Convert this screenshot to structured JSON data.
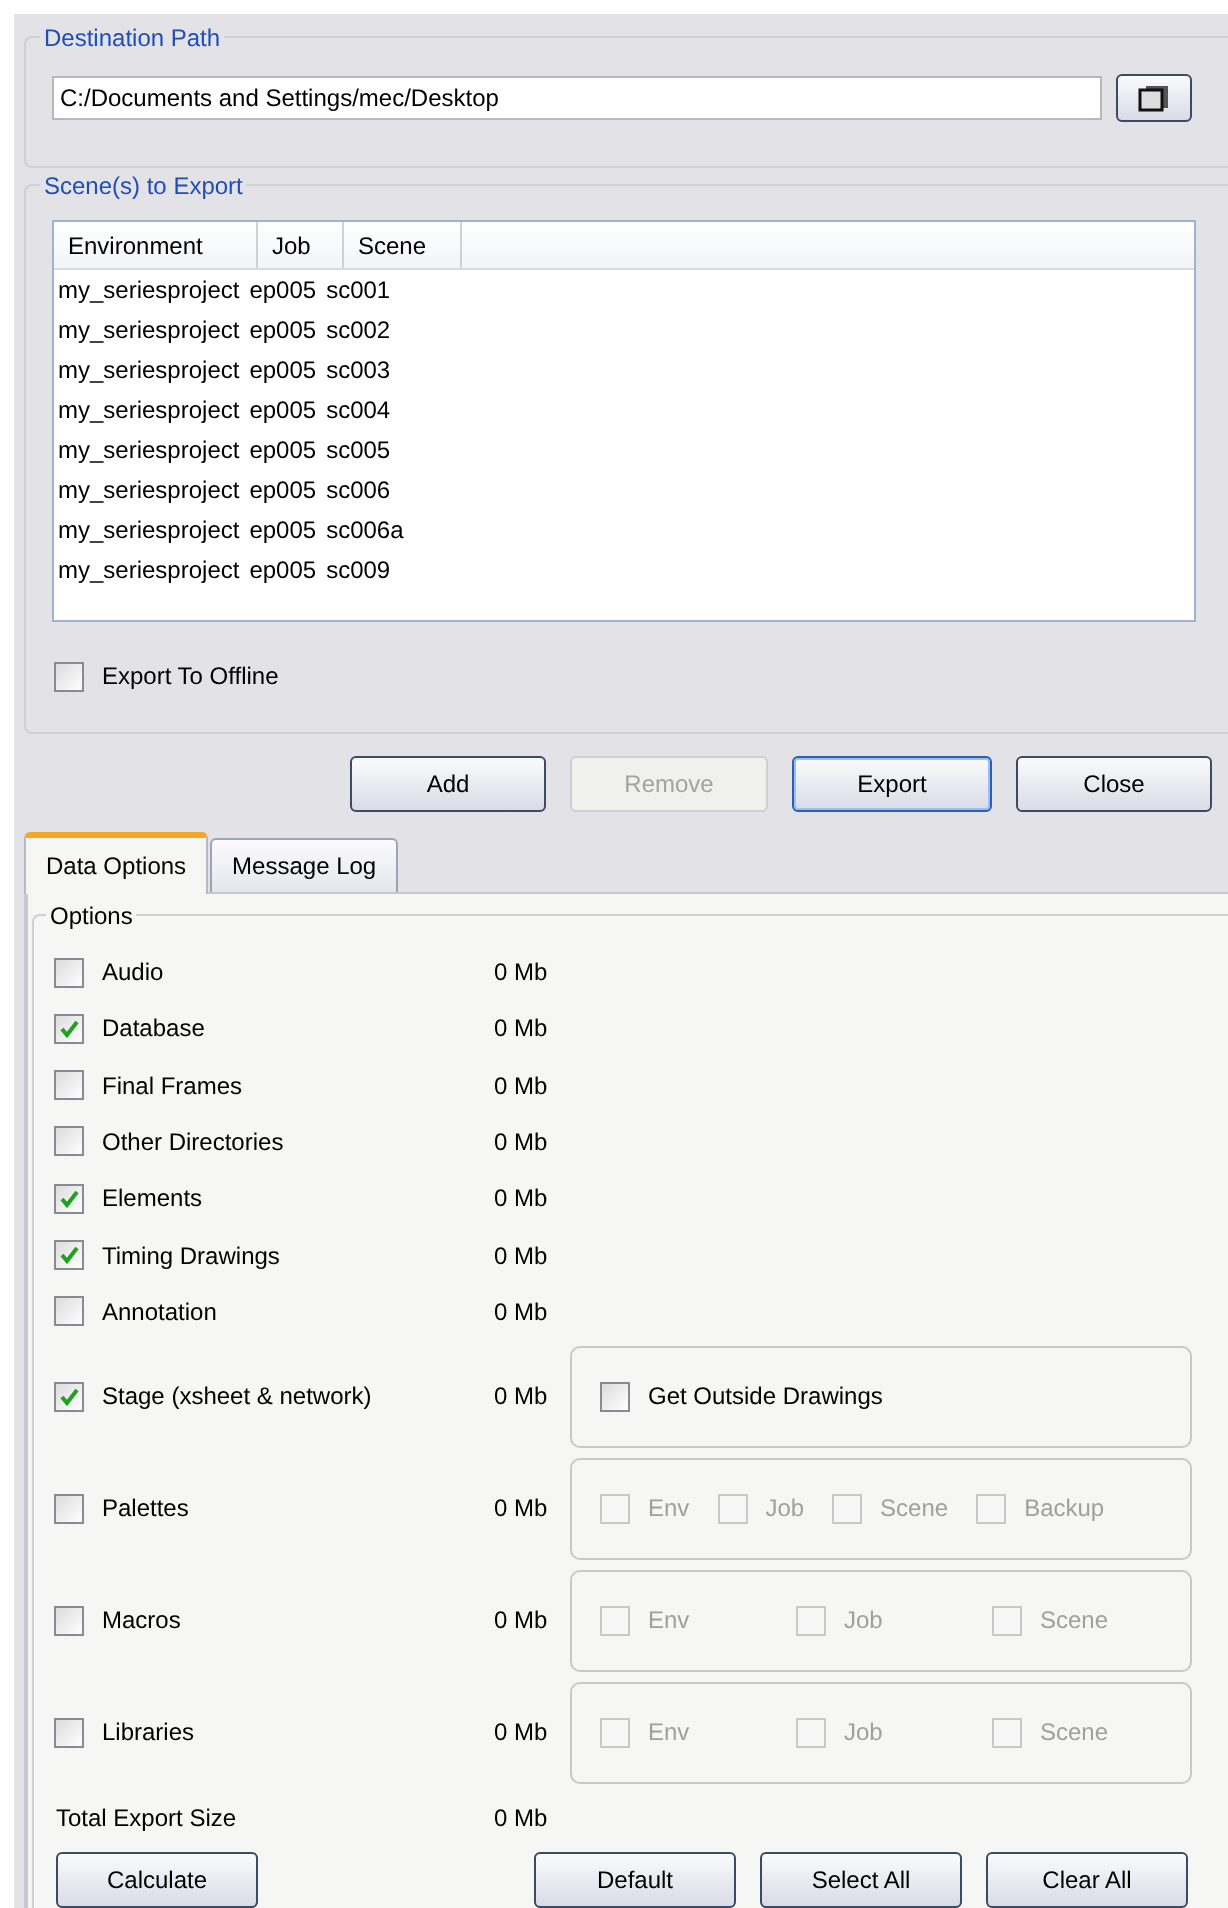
{
  "destination": {
    "legend": "Destination Path",
    "value": "C:/Documents and Settings/mec/Desktop"
  },
  "scenes": {
    "legend": "Scene(s) to Export",
    "columns": [
      "Environment",
      "Job",
      "Scene"
    ],
    "rows": [
      [
        "my_seriesproject",
        "ep005",
        "sc001"
      ],
      [
        "my_seriesproject",
        "ep005",
        "sc002"
      ],
      [
        "my_seriesproject",
        "ep005",
        "sc003"
      ],
      [
        "my_seriesproject",
        "ep005",
        "sc004"
      ],
      [
        "my_seriesproject",
        "ep005",
        "sc005"
      ],
      [
        "my_seriesproject",
        "ep005",
        "sc006"
      ],
      [
        "my_seriesproject",
        "ep005",
        "sc006a"
      ],
      [
        "my_seriesproject",
        "ep005",
        "sc009"
      ]
    ],
    "export_offline": {
      "label": "Export To Offline",
      "checked": false
    }
  },
  "actions": [
    {
      "label": "Add",
      "disabled": false,
      "default": false
    },
    {
      "label": "Remove",
      "disabled": true,
      "default": false
    },
    {
      "label": "Export",
      "disabled": false,
      "default": true
    },
    {
      "label": "Close",
      "disabled": false,
      "default": false
    }
  ],
  "tabs": [
    {
      "label": "Data Options",
      "selected": true
    },
    {
      "label": "Message Log",
      "selected": false
    }
  ],
  "options": {
    "legend": "Options",
    "items": [
      {
        "label": "Audio",
        "checked": false,
        "size": "0 Mb"
      },
      {
        "label": "Database",
        "checked": true,
        "size": "0 Mb"
      },
      {
        "label": "Final Frames",
        "checked": false,
        "size": "0 Mb"
      },
      {
        "label": "Other Directories",
        "checked": false,
        "size": "0 Mb"
      },
      {
        "label": "Elements",
        "checked": true,
        "size": "0 Mb"
      },
      {
        "label": "Timing Drawings",
        "checked": true,
        "size": "0 Mb"
      },
      {
        "label": "Annotation",
        "checked": false,
        "size": "0 Mb"
      },
      {
        "label": "Stage (xsheet & network)",
        "checked": true,
        "size": "0 Mb",
        "sub": {
          "kind": "spread",
          "items": [
            {
              "label": "Get Outside Drawings",
              "checked": false,
              "disabled": false
            }
          ]
        }
      },
      {
        "label": "Palettes",
        "checked": false,
        "size": "0 Mb",
        "sub": {
          "kind": "packed",
          "items": [
            {
              "label": "Env",
              "checked": false,
              "disabled": true
            },
            {
              "label": "Job",
              "checked": false,
              "disabled": true
            },
            {
              "label": "Scene",
              "checked": false,
              "disabled": true
            },
            {
              "label": "Backup",
              "checked": false,
              "disabled": true
            }
          ]
        }
      },
      {
        "label": "Macros",
        "checked": false,
        "size": "0 Mb",
        "sub": {
          "kind": "spread",
          "items": [
            {
              "label": "Env",
              "checked": false,
              "disabled": true
            },
            {
              "label": "Job",
              "checked": false,
              "disabled": true
            },
            {
              "label": "Scene",
              "checked": false,
              "disabled": true
            }
          ]
        }
      },
      {
        "label": "Libraries",
        "checked": false,
        "size": "0 Mb",
        "sub": {
          "kind": "spread",
          "items": [
            {
              "label": "Env",
              "checked": false,
              "disabled": true
            },
            {
              "label": "Job",
              "checked": false,
              "disabled": true
            },
            {
              "label": "Scene",
              "checked": false,
              "disabled": true
            }
          ]
        }
      }
    ],
    "total": {
      "label": "Total Export Size",
      "value": "0 Mb"
    }
  },
  "bottom_buttons": [
    {
      "label": "Calculate"
    },
    {
      "label": "Default"
    },
    {
      "label": "Select All"
    },
    {
      "label": "Clear All"
    }
  ]
}
